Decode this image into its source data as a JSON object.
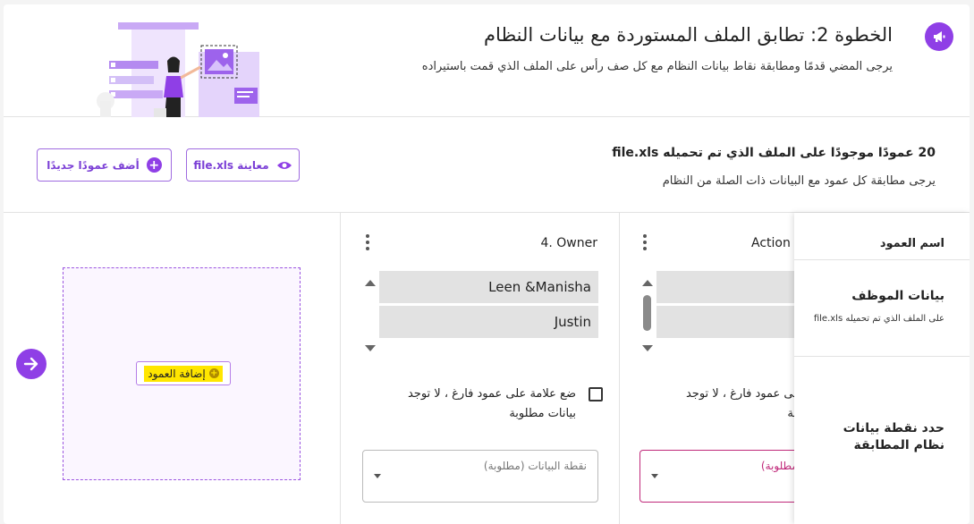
{
  "header": {
    "title": "الخطوة 2: تطابق الملف المستوردة مع بيانات النظام",
    "subtitle": "يرجى المضي قدمًا ومطابقة نقاط بيانات النظام مع كل صف رأس على الملف الذي قمت باستيراده",
    "icon": "megaphone-icon"
  },
  "summary": {
    "count_text": "20 عمودًا موجودًا على الملف الذي تم تحميله file.xls",
    "hint": "يرجى مطابقة كل عمود مع البيانات ذات الصلة من النظام"
  },
  "toolbar": {
    "preview_label": "معاينة file.xls",
    "add_column_label": "أضف عمودًا جديدًا"
  },
  "row_panel": {
    "column_name_label": "اسم العمود",
    "employee_data_label": "بيانات الموظف",
    "employee_data_sub": "على الملف الذي تم تحميله file.xls",
    "define_label": "حدد نقطة بيانات نظام المطابقة"
  },
  "columns": [
    {
      "name": "4. Owner",
      "options": [
        "Leen &Manisha",
        "Justin"
      ],
      "checkbox_label": "ضع علامة على عمود فارغ ، لا توجد بيانات مطلوبة",
      "select_placeholder": "نقطة البيانات (مطلوبة)"
    },
    {
      "name": "Action",
      "options": [
        "",
        ""
      ],
      "checkbox_label": "ضع علامة على عمود فارغ ، لا توجد بيانات مطلوبة",
      "select_placeholder": "نقطة البيانات (مطلوبة)"
    }
  ],
  "dropzone": {
    "add_column_label": "إضافة العمود"
  },
  "colors": {
    "accent": "#8f3fe6",
    "highlight": "#ffe600",
    "error": "#c0297a"
  }
}
